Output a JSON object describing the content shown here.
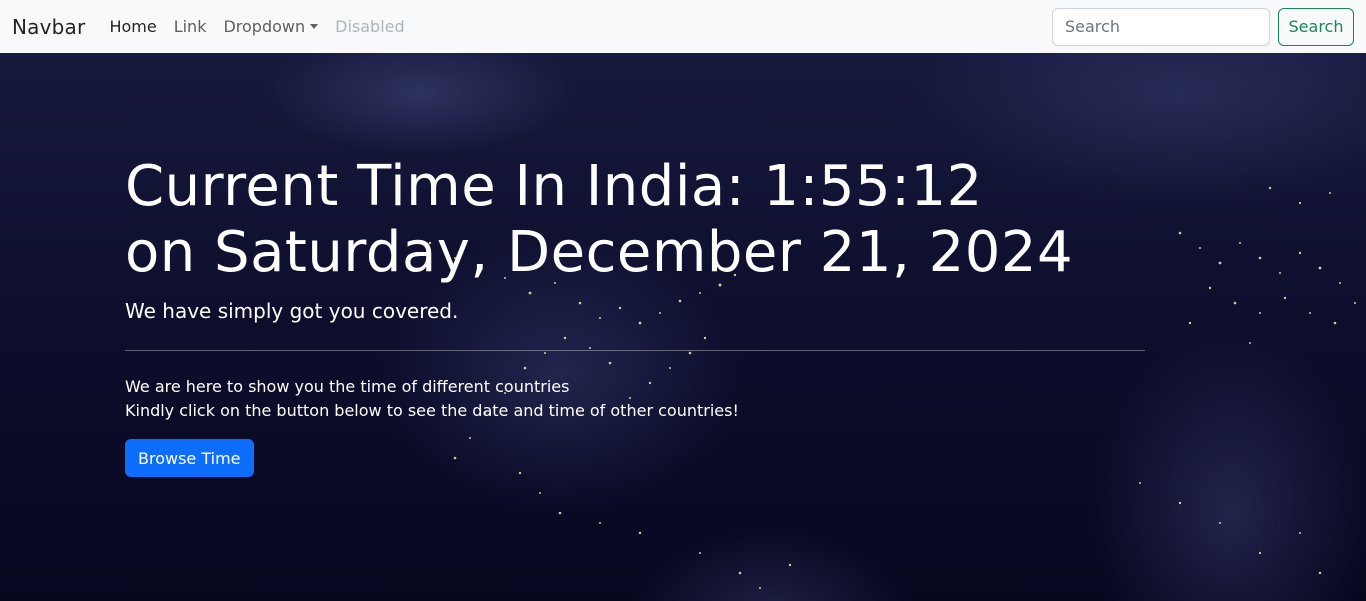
{
  "navbar": {
    "brand": "Navbar",
    "links": [
      {
        "label": "Home"
      },
      {
        "label": "Link"
      },
      {
        "label": "Dropdown"
      },
      {
        "label": "Disabled"
      }
    ],
    "search": {
      "placeholder": "Search",
      "button_label": "Search"
    }
  },
  "hero": {
    "title_line1": "Current Time In India: 1:55:12",
    "title_line2": "on Saturday, December 21, 2024",
    "lead": "We have simply got you covered.",
    "desc_line1": "We are here to show you the time of different countries",
    "desc_line2": "Kindly click on the button below to see the date and time of other countries!",
    "button_label": "Browse Time"
  },
  "colors": {
    "primary": "#0d6efd",
    "success": "#198754",
    "navbar_bg": "#f8f9fa",
    "hero_bg": "#0d0e2c"
  },
  "icons": {
    "dropdown": "caret-down-icon"
  }
}
